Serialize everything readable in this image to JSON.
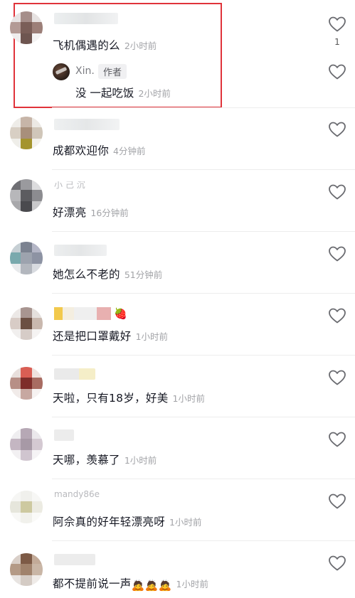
{
  "comments": [
    {
      "text": "飞机偶遇的么",
      "time": "2小时前",
      "likes": "1"
    },
    {
      "text": "成都欢迎你",
      "time": "4分钟前"
    },
    {
      "text": "好漂亮",
      "time": "16分钟前",
      "name_fragment": "小 己 沉"
    },
    {
      "text": "她怎么不老的",
      "time": "51分钟前"
    },
    {
      "text": "还是把口罩戴好",
      "time": "1小时前"
    },
    {
      "text": "天啦，只有18岁，好美",
      "time": "1小时前"
    },
    {
      "text": "天哪，羡慕了",
      "time": "1小时前"
    },
    {
      "text": "阿佘真的好年轻漂亮呀",
      "time": "1小时前",
      "name_fragment": "mandy86e"
    },
    {
      "text": "都不提前说一声",
      "time": "1小时前",
      "emojis": "🙇🙇🙇"
    }
  ],
  "reply": {
    "name": "Xin.",
    "badge": "作者",
    "text": "没 一起吃饭",
    "time": "2小时前"
  },
  "icons": {
    "like": "heart-outline-icon"
  },
  "colors": {
    "highlight": "#e0333a",
    "text": "#161823",
    "time": "#a2a3a7"
  }
}
